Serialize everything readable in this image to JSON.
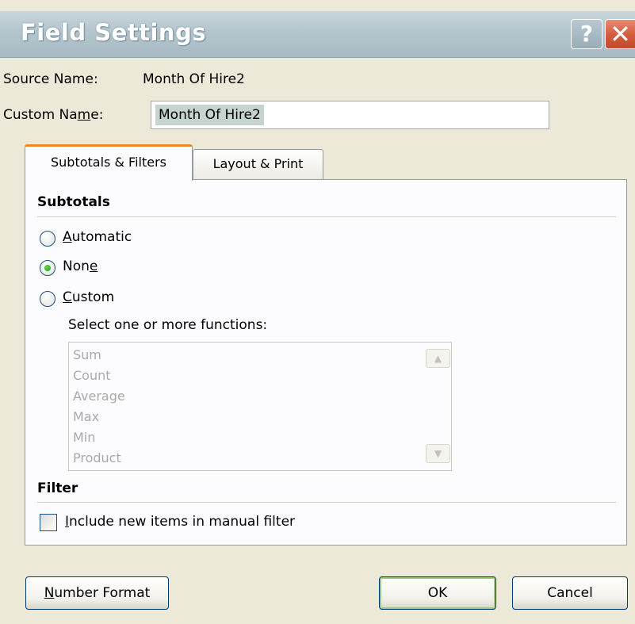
{
  "dialog": {
    "title": "Field Settings",
    "help_symbol": "?",
    "close_symbol": "✕"
  },
  "source": {
    "label": "Source Name:",
    "value": "Month Of Hire2"
  },
  "custom": {
    "label_pre": "Custom Na",
    "label_u": "m",
    "label_post": "e:",
    "value": "Month Of Hire2"
  },
  "tabs": [
    {
      "label": "Subtotals & Filters",
      "active": true
    },
    {
      "label": "Layout & Print",
      "active": false
    }
  ],
  "subtotals": {
    "title": "Subtotals",
    "options": [
      {
        "u": "A",
        "rest": "utomatic",
        "pre": "",
        "selected": false
      },
      {
        "pre": "Non",
        "u": "e",
        "rest": "",
        "selected": true
      },
      {
        "u": "C",
        "rest": "ustom",
        "pre": "",
        "selected": false
      }
    ],
    "functions_label": "Select one or more functions:",
    "functions": [
      "Sum",
      "Count",
      "Average",
      "Max",
      "Min",
      "Product"
    ]
  },
  "filter": {
    "title": "Filter",
    "checkbox_u": "I",
    "checkbox_rest": "nclude new items in manual filter",
    "checked": false
  },
  "buttons": {
    "number_format_u": "N",
    "number_format_rest": "umber Format",
    "ok": "OK",
    "cancel": "Cancel"
  },
  "colors": {
    "accent_tab": "#e68b2c",
    "selection": "#c5d4ce",
    "radio_dot": "#21a121"
  }
}
